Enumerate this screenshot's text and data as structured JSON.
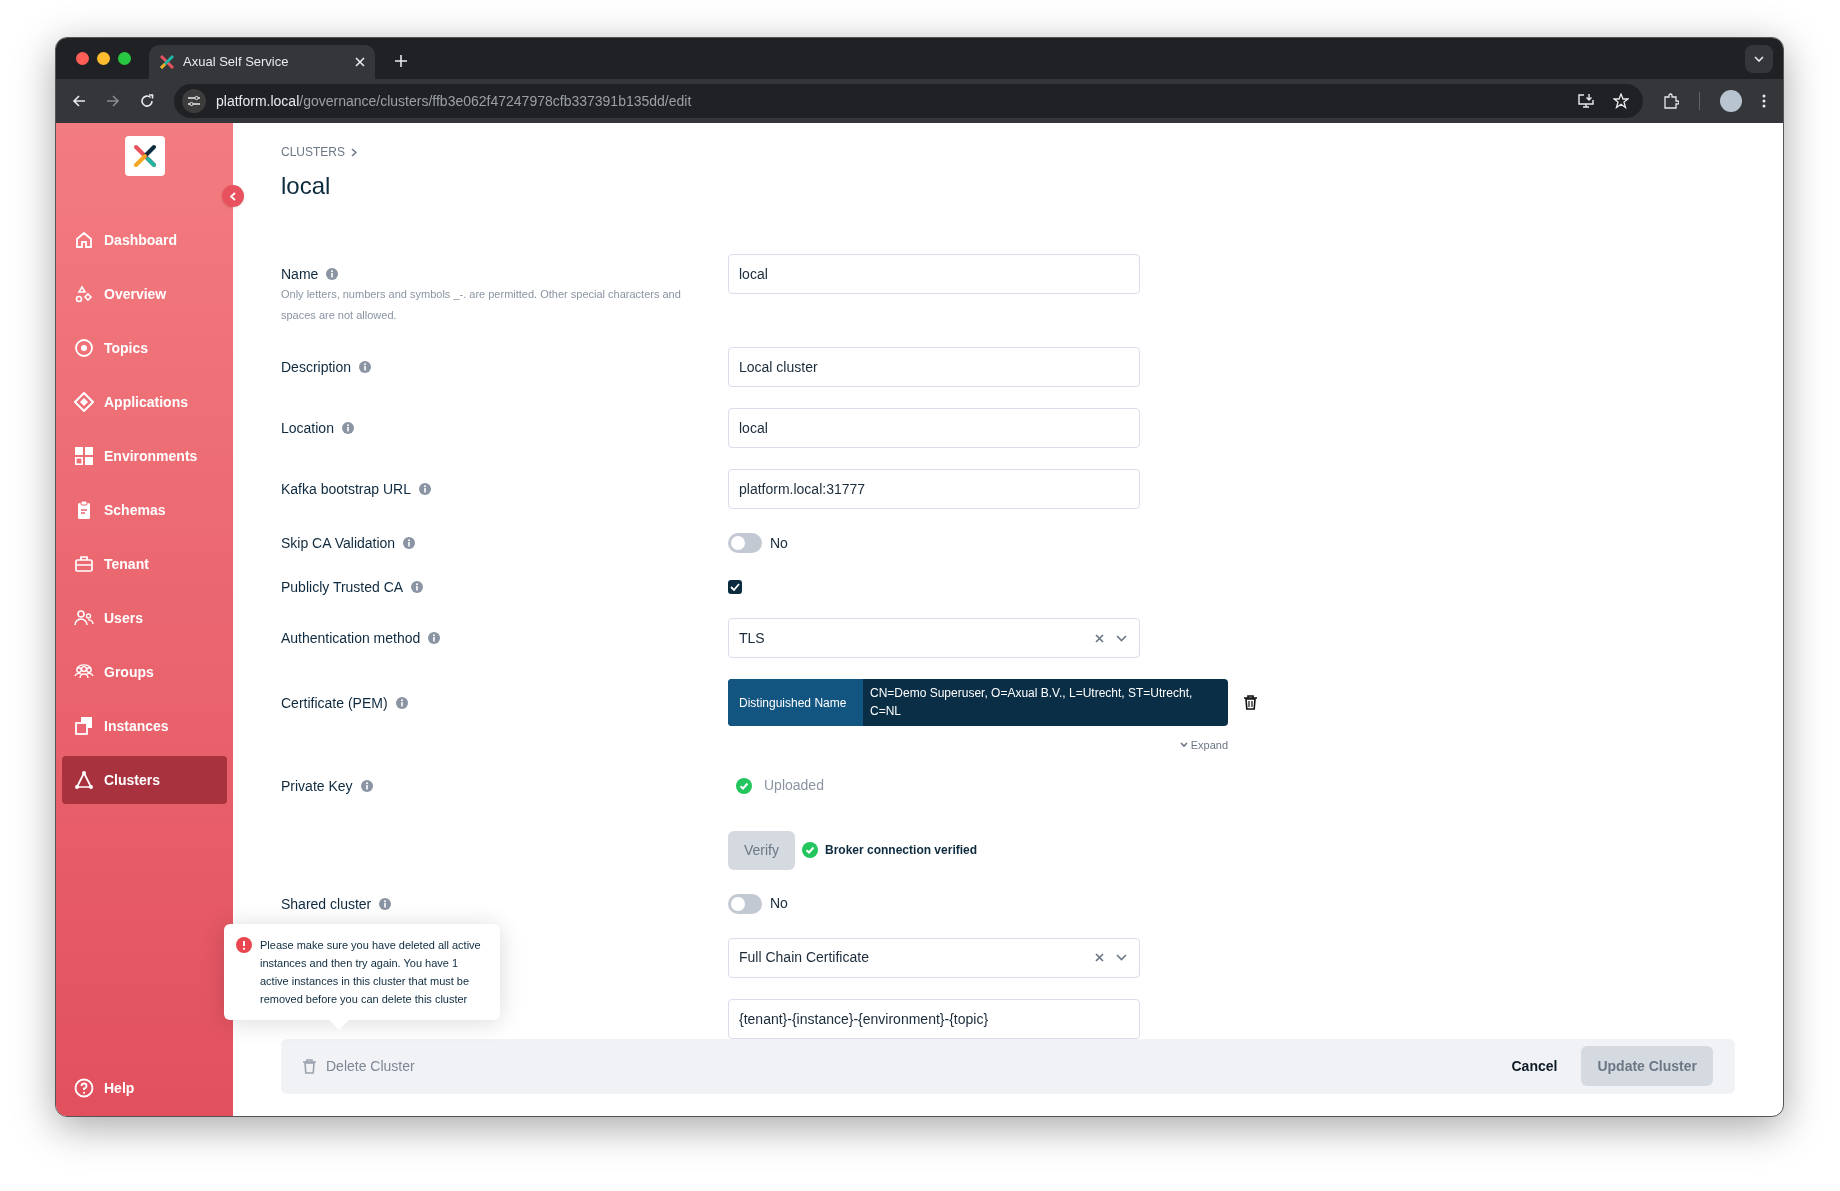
{
  "browser": {
    "tab_title": "Axual Self Service",
    "url_host": "platform.local",
    "url_path": "/governance/clusters/ffb3e062f47247978cfb337391b135dd/edit"
  },
  "sidebar": {
    "items": [
      {
        "label": "Dashboard",
        "selected": false
      },
      {
        "label": "Overview",
        "selected": false
      },
      {
        "label": "Topics",
        "selected": false
      },
      {
        "label": "Applications",
        "selected": false
      },
      {
        "label": "Environments",
        "selected": false
      },
      {
        "label": "Schemas",
        "selected": false
      },
      {
        "label": "Tenant",
        "selected": false
      },
      {
        "label": "Users",
        "selected": false
      },
      {
        "label": "Groups",
        "selected": false
      },
      {
        "label": "Instances",
        "selected": false
      },
      {
        "label": "Clusters",
        "selected": true
      }
    ],
    "help": "Help"
  },
  "breadcrumb": "CLUSTERS",
  "title": "local",
  "fields": [
    {
      "kind": "text",
      "label": "Name",
      "hint": "Only letters, numbers and symbols _-. are permitted. Other special characters and spaces are not allowed.",
      "value": "local"
    },
    {
      "kind": "text",
      "label": "Description",
      "value": "Local cluster"
    },
    {
      "kind": "text",
      "label": "Location",
      "value": "local"
    },
    {
      "kind": "text",
      "label": "Kafka bootstrap URL",
      "value": "platform.local:31777"
    },
    {
      "kind": "toggle",
      "label": "Skip CA Validation",
      "on": false,
      "state_label": "No"
    },
    {
      "kind": "checkbox",
      "label": "Publicly Trusted CA",
      "checked": true
    },
    {
      "kind": "select",
      "label": "Authentication method",
      "value": "TLS"
    },
    {
      "kind": "certificate",
      "label": "Certificate (PEM)",
      "key": "Distinguished Name",
      "value": "CN=Demo Superuser, O=Axual B.V., L=Utrecht, ST=Utrecht, C=NL",
      "expand": "Expand"
    },
    {
      "kind": "status",
      "label": "Private Key",
      "status": "Uploaded"
    },
    {
      "kind": "verify",
      "button": "Verify",
      "disabled": true,
      "message": "Broker connection verified"
    },
    {
      "kind": "toggle",
      "label": "Shared cluster",
      "on": false,
      "state_label": "No"
    },
    {
      "kind": "select",
      "value": "Full Chain Certificate"
    },
    {
      "kind": "text",
      "value": "{tenant}-{instance}-{environment}-{topic}"
    }
  ],
  "tooltip": "Please make sure you have deleted all active instances and then try again. You have 1 active instances in this cluster that must be removed before you can delete this cluster",
  "footer": {
    "delete": {
      "label": "Delete Cluster",
      "disabled": true
    },
    "cancel": "Cancel",
    "update": {
      "label": "Update Cluster",
      "disabled": true
    }
  }
}
